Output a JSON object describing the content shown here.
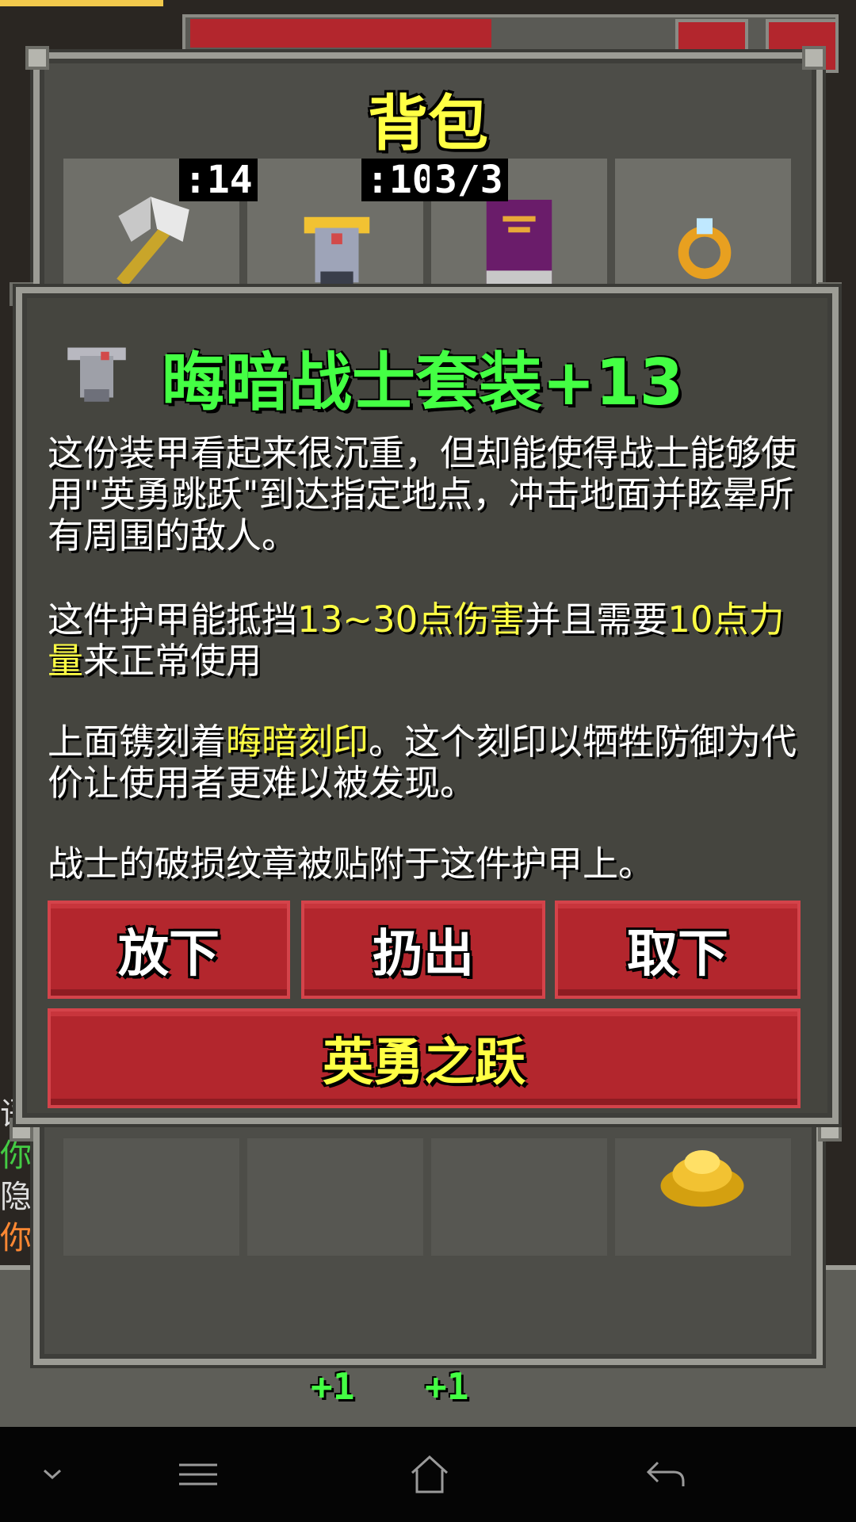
{
  "bag": {
    "title": "背包"
  },
  "slots": [
    {
      "name": "weapon",
      "badge": ":14"
    },
    {
      "name": "armor",
      "badge": ":10"
    },
    {
      "name": "artifact",
      "badge": "3/3"
    },
    {
      "name": "ring",
      "badge": ""
    }
  ],
  "item": {
    "title": "晦暗战士套装+13",
    "desc1": "这份装甲看起来很沉重，但却能使得战士能够使用\"英勇跳跃\"到达指定地点，冲击地面并眩晕所有周围的敌人。",
    "desc2_a": "这件护甲能抵挡",
    "desc2_hl1": "13~30点伤害",
    "desc2_b": "并且需要",
    "desc2_hl2": "10点力量",
    "desc2_c": "来正常使用",
    "desc3_a": "上面镌刻着",
    "desc3_hl": "晦暗刻印",
    "desc3_b": "。这个刻印以牺牲防御为代价让使用者更难以被发现。",
    "desc4": "战士的破损纹章被贴附于这件护甲上。"
  },
  "buttons": {
    "drop": "放下",
    "throw": "扔出",
    "unequip": "取下",
    "heroic_leap": "英勇之跃"
  },
  "log": [
    "语",
    "你",
    "隐",
    "你"
  ],
  "quickbar": {
    "plus1": "+1",
    "plus2": "+1"
  },
  "colors": {
    "title_yellow": "#ffff44",
    "item_green": "#44ff44",
    "button_red": "#b3262d",
    "panel_grey": "#4d4d48"
  }
}
